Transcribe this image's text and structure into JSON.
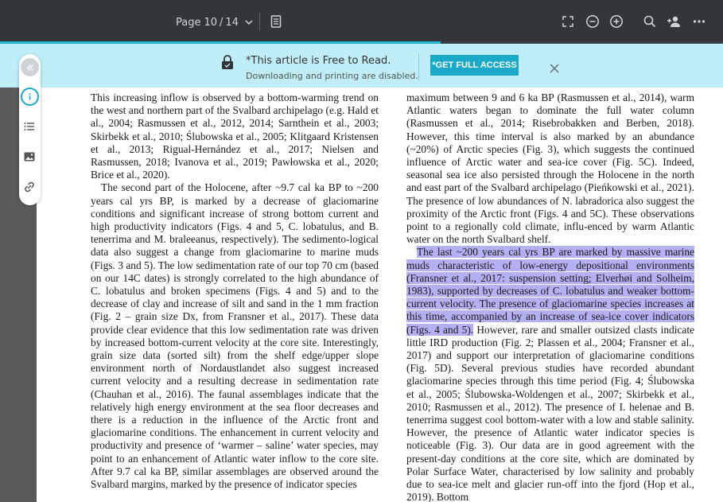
{
  "toolbar": {
    "page_label": "Page",
    "page_current": "10",
    "page_sep": "/",
    "page_total": "14",
    "reading_progress": 0.61,
    "icons": [
      "chevron-down-icon",
      "document-outline-icon",
      "fullscreen-icon",
      "zoom-out-icon",
      "zoom-in-icon",
      "search-icon",
      "share-user-icon",
      "more-icon"
    ],
    "accent_color": "#26b5d1",
    "background_color": "#323639"
  },
  "banner": {
    "title": "*This article is Free to Read.",
    "subtitle": "Downloading and printing are disabled.",
    "cta_label": "*GET FULL ACCESS",
    "background_color": "#bfeef8",
    "cta_color": "#1aa9c9",
    "icons": [
      "lock-icon",
      "close-icon"
    ]
  },
  "rail": {
    "icons": [
      "collapse-icon",
      "info-icon",
      "list-icon",
      "image-icon",
      "link-icon"
    ]
  },
  "document": {
    "left_column": [
      "This increasing inflow is observed by a bottom-warming trend on the west and northern part of the Svalbard archipelago (e.g. Hald et al., 2004; Rasmussen et al., 2012, 2014; Sarnthein et al., 2003; Skirbekk et al., 2010; Ślubowska et al., 2005; Klitgaard Kristensen et al., 2013; Rigual-Hernández et al., 2017; Nielsen and Rasmussen, 2018; Ivanova et al., 2019; Pawłowska et al., 2020; Brice et al., 2020).",
      "The second part of the Holocene, after ~9.7 cal ka BP to ~200 years cal yrs BP, is marked by a decrease of glaciomarine conditions and significant increase of strong bottom current and high productivity indicators (Figs. 4 and 5, C. lobatulus, and B. tenerrima and M. braleeanus, respectively). The sedimento-logical data also suggest a change from glaciomarine to marine muds (Figs. 3 and 5). The low sedimentation rate of our top 70 cm (based on our 14C dates) is strongly correlated to the high abundance of C. lobatulus and broken specimens (Figs. 4 and 5) and to the decrease of clay and increase of silt and sand in the 1 mm fraction (Fig. 2 – grain size Dx, from Fransner et al., 2017). These data provide clear evidence that this low sedimentation rate was driven by increased bottom-current velocity at the core site. Interestingly, grain size data (sorted silt) from the shelf edge/upper slope environment north of Nordaustlandet also suggest increased current velocity and a resulting decrease in sedimentation rate (Chauhan et al., 2016). The faunal assemblages indicate that the relatively high energy environment at the sea floor decreases and there is a reduction in the influence of the Arctic front and glaciomarine conditions. The enhancement in current velocity and productivity and presence of ‘warmer – saline’ water species, may point to an enhancement of Atlantic water inflow to the core site. After 9.7 cal ka BP, similar assemblages are observed around the Svalbard margins, marked by the presence of indicator species"
    ],
    "right_column": [
      "maximum between 9 and 6 ka BP (Rasmussen et al., 2014), warm Atlantic waters began to dominate the full water column (Rasmussen et al., 2014; Risebrobakken and Berben, 2018). However, this time interval is also marked by an abundance (~20%) of Arctic species (Fig. 3), which suggests the continued influence of Arctic water and sea-ice cover (Fig. 5C). Indeed, seasonal sea ice also persisted through the Holocene in the north and east part of the Svalbard archipelago (Pieńkowski et al., 2021). The presence of low abundances of N. labradorica also suggest the proximity of the Arctic front (Figs. 4 and 5C). These observations point to a regionally cold climate, influ-enced by warm Atlantic water on the north Svalbard shelf."
    ],
    "right_selected": "The last ~200 years cal yrs BP are marked by massive marine muds characteristic of low-energy depositional environments (Fransner et al., 2017: suspension setting; Elverhøi and Solheim, 1983), supported by decreases of C. lobatulus and weaker bottom-current velocity. The presence of glaciomarine species increases at this time, accompanied by an increase of sea-ice cover indicators (Figs. 4 and 5).",
    "right_after": " However, rare and smaller outsized clasts indicate little IRD production (Fig. 2; Plassen et al., 2004; Fransner et al., 2017) and support our interpretation of glaciomarine conditions (Fig. 5D). Several previous studies have recorded abundant glaciomarine species through this time period (Fig. 4; Ślubowska et al., 2005; Ślubowska-Woldengen et al., 2007; Skirbekk et al., 2010; Rasmussen et al., 2012). The presence of I. helenae and B. tenerrima suggest cool bottom-water with a low and stable salinity. However, the presence of Atlantic water indicator species is noticeable (Fig. 3). Our data are in good agreement with the present-day conditions at the core site, which are dominated by Polar Surface Water, characterised by low salinity and probably due to sea-ice melt and glacier run-off into the fjord (Hop et al., 2019). Bottom",
    "selection_color": "#b3b1f3"
  }
}
